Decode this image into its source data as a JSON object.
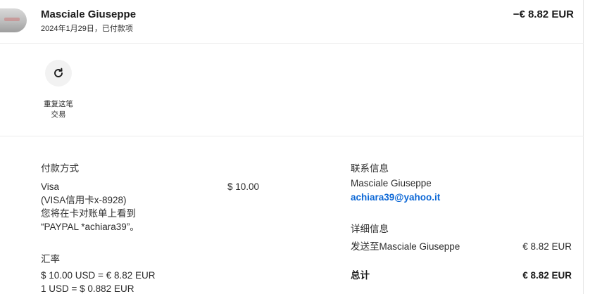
{
  "header": {
    "merchant_name": "Masciale Giuseppe",
    "date_status": "2024年1月29日，已付款项",
    "amount": "−€ 8.82 EUR"
  },
  "actions": {
    "repeat_label_line1": "重复这笔",
    "repeat_label_line2": "交易"
  },
  "payment": {
    "section_title": "付款方式",
    "method": "Visa",
    "card": "(VISA信用卡x-8928)",
    "statement_note_line1": "您将在卡对账单上看到",
    "statement_note_line2": "“PAYPAL *achiara39”。",
    "amount": "$ 10.00"
  },
  "exchange": {
    "section_title": "汇率",
    "conversion": "$ 10.00 USD = € 8.82 EUR",
    "rate": "1 USD = $ 0.882 EUR"
  },
  "contact": {
    "section_title": "联系信息",
    "name": "Masciale Giuseppe",
    "email": "achiara39@yahoo.it"
  },
  "breakdown": {
    "section_title": "详细信息",
    "sent_to_label": "发送至Masciale Giuseppe",
    "sent_to_amount": "€ 8.82 EUR",
    "total_label": "总计",
    "total_amount": "€ 8.82 EUR"
  },
  "colors": {
    "link": "#0d68d6",
    "text": "#2c2c2c",
    "divider": "#ececec"
  }
}
